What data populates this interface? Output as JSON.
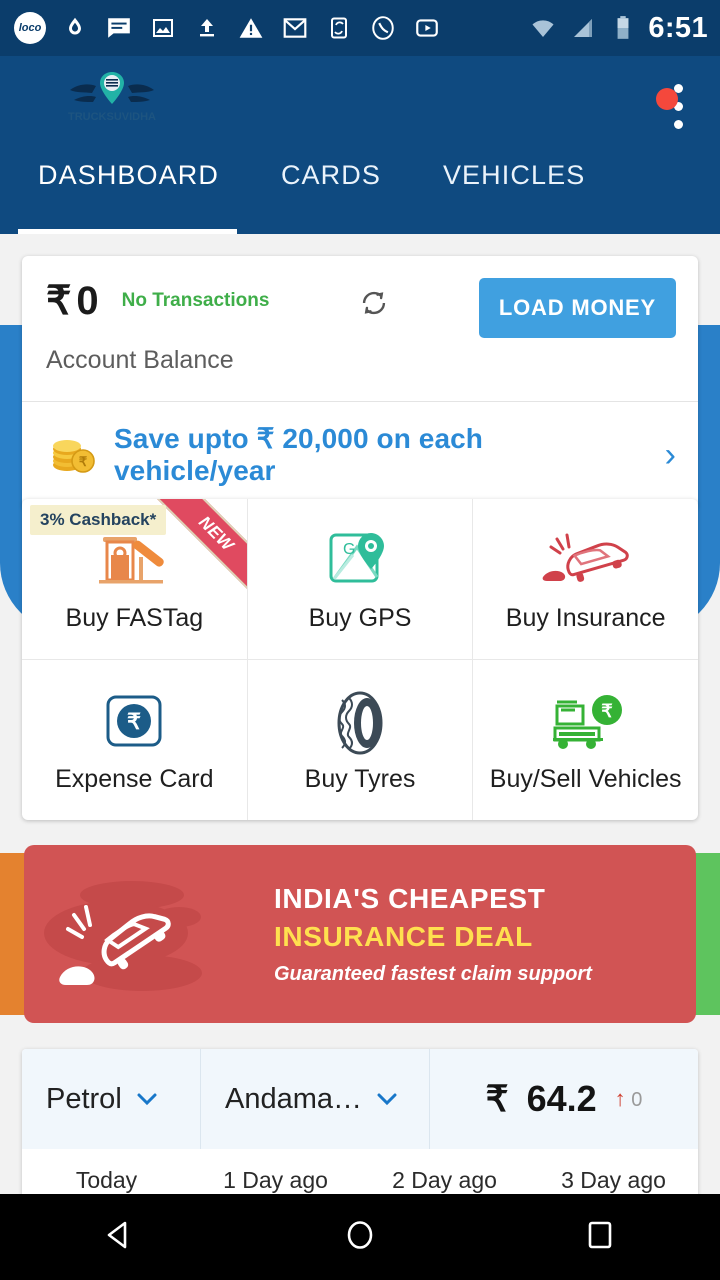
{
  "status_bar": {
    "time": "6:51",
    "left_icons": [
      "loco-badge-icon",
      "drop-sync-icon",
      "message-icon",
      "image-icon",
      "upload-icon",
      "warning-icon",
      "gmail-icon",
      "phone-sync-icon",
      "call-icon",
      "youtube-icon"
    ],
    "right_icons": [
      "wifi-icon",
      "signal-icon",
      "battery-icon"
    ]
  },
  "app_bar": {
    "logo_name": "winged-pin-logo",
    "overflow_menu": "more-options",
    "notification_badge": true,
    "tabs": [
      {
        "label": "DASHBOARD",
        "active": true
      },
      {
        "label": "CARDS",
        "active": false
      },
      {
        "label": "VEHICLES",
        "active": false
      }
    ]
  },
  "balance": {
    "currency": "₹",
    "amount": "0",
    "transactions_status": "No Transactions",
    "caption": "Account Balance",
    "refresh_icon": "refresh-icon",
    "load_money_label": "LOAD MONEY",
    "promo_text": "Save upto ₹ 20,000 on each vehicle/year",
    "promo_chevron": "›"
  },
  "services": {
    "rows": [
      [
        {
          "label": "Buy FASTag",
          "icon": "toll-booth-icon",
          "badge": "3% Cashback*",
          "ribbon": "NEW"
        },
        {
          "label": "Buy GPS",
          "icon": "map-pin-icon",
          "badge": null,
          "ribbon": null
        },
        {
          "label": "Buy Insurance",
          "icon": "car-crash-icon",
          "badge": null,
          "ribbon": null
        }
      ],
      [
        {
          "label": "Expense Card",
          "icon": "rupee-card-icon",
          "badge": null,
          "ribbon": null
        },
        {
          "label": "Buy Tyres",
          "icon": "tyre-icon",
          "badge": null,
          "ribbon": null
        },
        {
          "label": "Buy/Sell Vehicles",
          "icon": "truck-rupee-icon",
          "badge": null,
          "ribbon": null
        }
      ]
    ]
  },
  "promo_banner": {
    "line1": "INDIA'S CHEAPEST",
    "line2": "INSURANCE DEAL",
    "line3": "Guaranteed fastest claim support",
    "art_icon": "car-crash-icon",
    "bg_color": "#d15454",
    "highlight_color": "#ffe04f",
    "prev_peek_color": "#e4822f",
    "next_peek_color": "#5ec45e"
  },
  "fuel": {
    "fuel_type": "Petrol",
    "state": "Andama…",
    "currency": "₹",
    "price": "64.2",
    "change_arrow": "↑",
    "change_value": "0",
    "days": [
      "Today",
      "1 Day ago",
      "2 Day ago",
      "3 Day ago"
    ]
  },
  "nav_bar": {
    "buttons": [
      "back-triangle-icon",
      "home-circle-icon",
      "recents-square-icon"
    ]
  },
  "colors": {
    "status_bar": "#0b3d6b",
    "app_bar": "#0f4a80",
    "blue_panel": "#2a80c8",
    "accent_blue": "#40a0e0",
    "link_blue": "#2b8ad6",
    "green": "#3fae49"
  }
}
